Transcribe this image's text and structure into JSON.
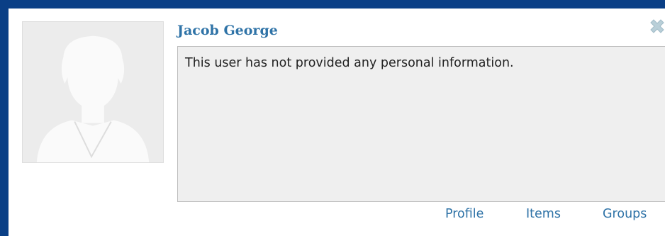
{
  "user": {
    "name": "Jacob George",
    "bio": "This user has not provided any personal information.",
    "avatar_icon": "default-user-avatar-icon"
  },
  "actions": {
    "close_icon": "close-icon"
  },
  "links": {
    "profile": "Profile",
    "items": "Items",
    "groups": "Groups"
  },
  "colors": {
    "frame": "#0a3f86",
    "link": "#2f73a7",
    "bio_background": "#efefef",
    "avatar_background": "#ececec"
  }
}
